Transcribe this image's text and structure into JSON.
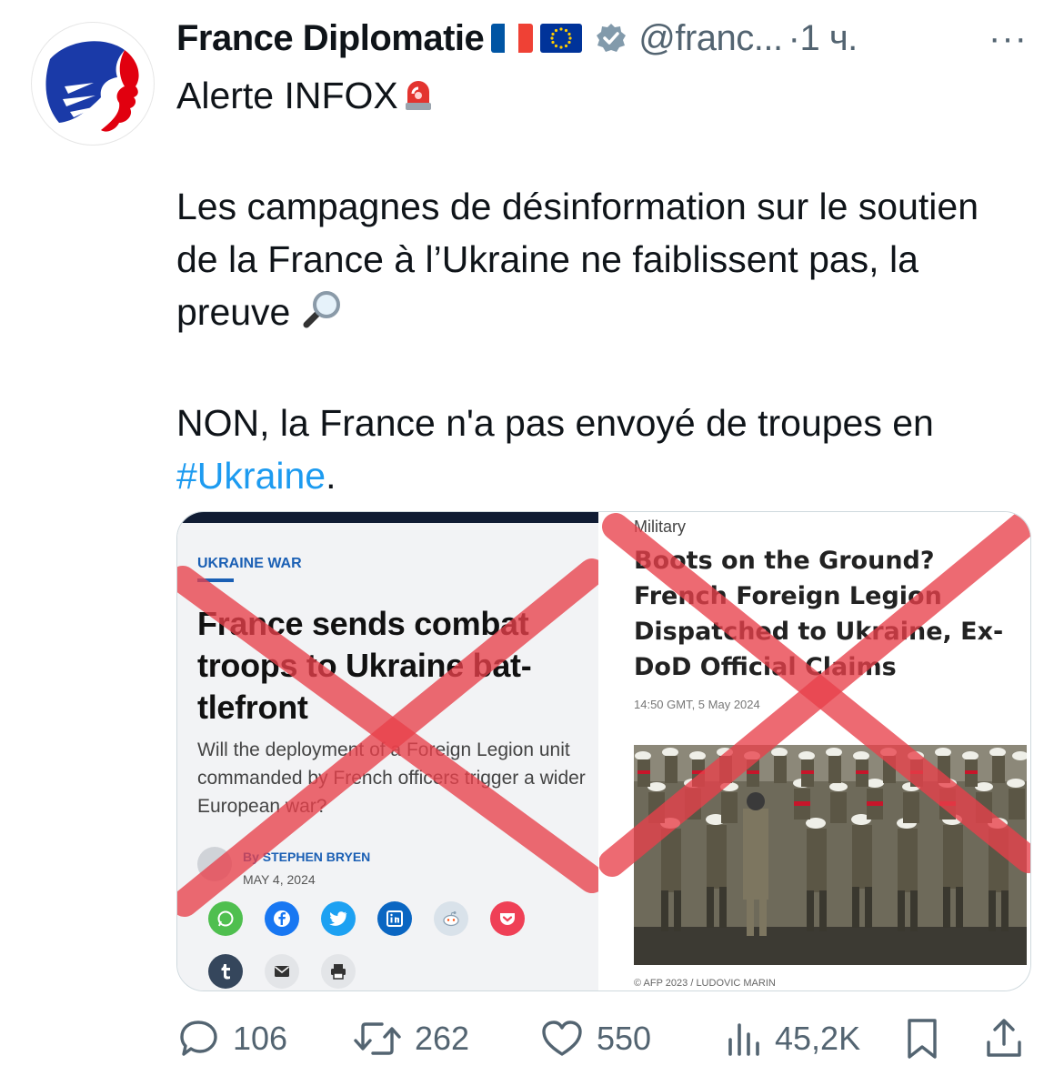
{
  "tweet": {
    "author_name": "France Diplomatie",
    "handle": "@franc...",
    "time": "·1 ч.",
    "more": "···",
    "line1": "Alerte INFOX",
    "para2": "Les campagnes de désinformation sur le soutien de la France à l’Ukraine ne faiblissent pas, la preuve",
    "para3_text": "NON, la France n'a pas envoyé de troupes en ",
    "para3_hashtag": "#Ukraine",
    "para3_end": "."
  },
  "left_article": {
    "kicker": "UKRAINE WAR",
    "title": "France sends combat troops to Ukraine bat-tlefront",
    "subtitle": "Will the deployment of a Foreign Legion unit commanded by French officers trigger a wider European war?",
    "byline": "By STEPHEN BRYEN",
    "date": "MAY 4, 2024",
    "share_icons": [
      "whatsapp-icon",
      "facebook-icon",
      "twitter-icon",
      "linkedin-icon",
      "reddit-icon",
      "pocket-icon",
      "tumblr-icon",
      "email-icon",
      "print-icon"
    ],
    "share_colors": {
      "whatsapp": "#4fbf4f",
      "facebook": "#1877f2",
      "twitter": "#1da1f2",
      "linkedin": "#0a66c2",
      "reddit": "#d9e2ea",
      "pocket": "#ef4056",
      "tumblr": "#35465c",
      "email": "#e3e5e8",
      "print": "#e3e5e8"
    }
  },
  "right_article": {
    "category": "Military",
    "title": "Boots on the Ground? French Foreign Legion Dispatched to Ukraine, Ex-DoD Official Claims",
    "timestamp": "14:50 GMT, 5 May 2024",
    "credit": "© AFP 2023 / LUDOVIC MARIN"
  },
  "actions": {
    "replies": "106",
    "reposts": "262",
    "likes": "550",
    "views": "45,2K"
  },
  "colors": {
    "link": "#1d9bf0",
    "muted": "#536471",
    "cross_red": "#e8404a"
  }
}
